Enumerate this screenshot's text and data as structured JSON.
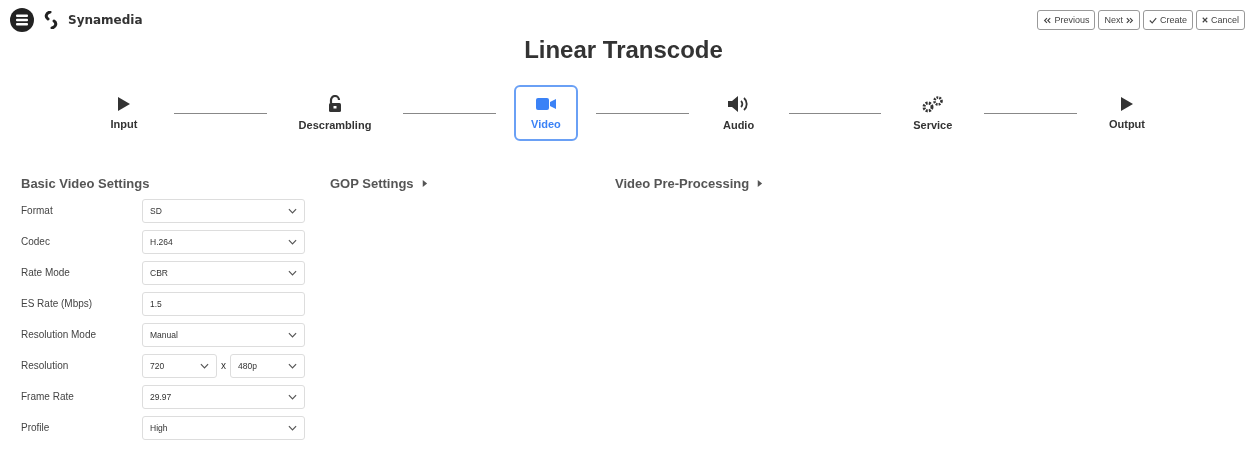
{
  "header": {
    "brand": "Synamedia"
  },
  "actions": [
    {
      "label": "Previous",
      "kind": "prev"
    },
    {
      "label": "Next",
      "kind": "next"
    },
    {
      "label": "Create",
      "kind": "check"
    },
    {
      "label": "Cancel",
      "kind": "cross"
    }
  ],
  "title": "Linear Transcode",
  "steps": [
    {
      "label": "Input",
      "kind": "play",
      "selected": false
    },
    {
      "label": "Descrambling",
      "kind": "lock",
      "selected": false
    },
    {
      "label": "Video",
      "kind": "camera",
      "selected": true
    },
    {
      "label": "Audio",
      "kind": "speaker",
      "selected": false
    },
    {
      "label": "Service",
      "kind": "gears",
      "selected": false
    },
    {
      "label": "Output",
      "kind": "play",
      "selected": false
    }
  ],
  "basic": {
    "heading": "Basic Video Settings",
    "fields": [
      {
        "label": "Format",
        "kind": "select",
        "value": "SD"
      },
      {
        "label": "Codec",
        "kind": "select",
        "value": "H.264"
      },
      {
        "label": "Rate Mode",
        "kind": "select",
        "value": "CBR"
      },
      {
        "label": "ES Rate (Mbps)",
        "kind": "text",
        "value": "1.5"
      },
      {
        "label": "Resolution Mode",
        "kind": "select",
        "value": "Manual"
      },
      {
        "label": "Resolution",
        "kind": "pair",
        "value": "720",
        "separator": "x",
        "value_2": "480p"
      },
      {
        "label": "Frame Rate",
        "kind": "select",
        "value": "29.97"
      },
      {
        "label": "Profile",
        "kind": "select",
        "value": "High"
      }
    ]
  },
  "collapsed_sections": [
    {
      "heading": "GOP Settings",
      "expanded": false
    },
    {
      "heading": "Video Pre-Processing",
      "expanded": false
    }
  ]
}
